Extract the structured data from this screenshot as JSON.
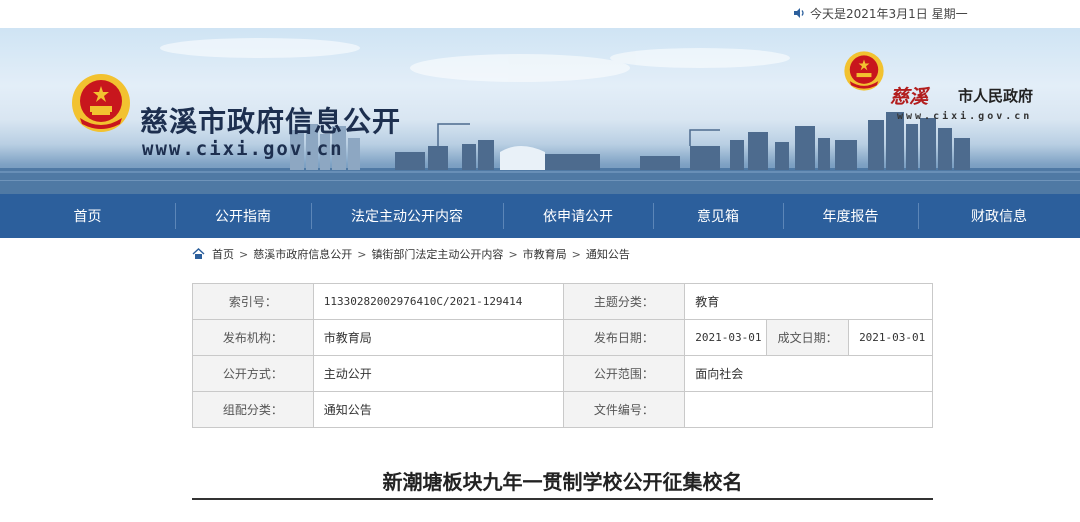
{
  "topbar": {
    "date_text": "今天是2021年3月1日 星期一"
  },
  "header": {
    "site_title": "慈溪市政府信息公开",
    "site_url": "www.cixi.gov.cn",
    "right_logo_name": "慈溪",
    "right_logo_sub": "市人民政府",
    "right_url": "www.cixi.gov.cn"
  },
  "nav": {
    "items": [
      {
        "label": "首页"
      },
      {
        "label": "公开指南"
      },
      {
        "label": "法定主动公开内容"
      },
      {
        "label": "依申请公开"
      },
      {
        "label": "意见箱"
      },
      {
        "label": "年度报告"
      },
      {
        "label": "财政信息"
      }
    ]
  },
  "breadcrumb": {
    "items": [
      "首页",
      "慈溪市政府信息公开",
      "镇街部门法定主动公开内容",
      "市教育局",
      "通知公告"
    ],
    "separator": ">"
  },
  "info": {
    "index_label": "索引号：",
    "index_value": "11330282002976410C/2021-129414",
    "topic_label": "主题分类：",
    "topic_value": "教育",
    "org_label": "发布机构：",
    "org_value": "市教育局",
    "pubdate_label": "发布日期：",
    "pubdate_value": "2021-03-01",
    "created_label": "成文日期：",
    "created_value": "2021-03-01",
    "method_label": "公开方式：",
    "method_value": "主动公开",
    "scope_label": "公开范围：",
    "scope_value": "面向社会",
    "category_label": "组配分类：",
    "category_value": "通知公告",
    "docno_label": "文件编号：",
    "docno_value": ""
  },
  "article": {
    "title": "新潮塘板块九年一贯制学校公开征集校名"
  },
  "colors": {
    "nav_bg": "#2c5f9c",
    "emblem_red": "#c8161d",
    "emblem_gold": "#f2c230"
  }
}
